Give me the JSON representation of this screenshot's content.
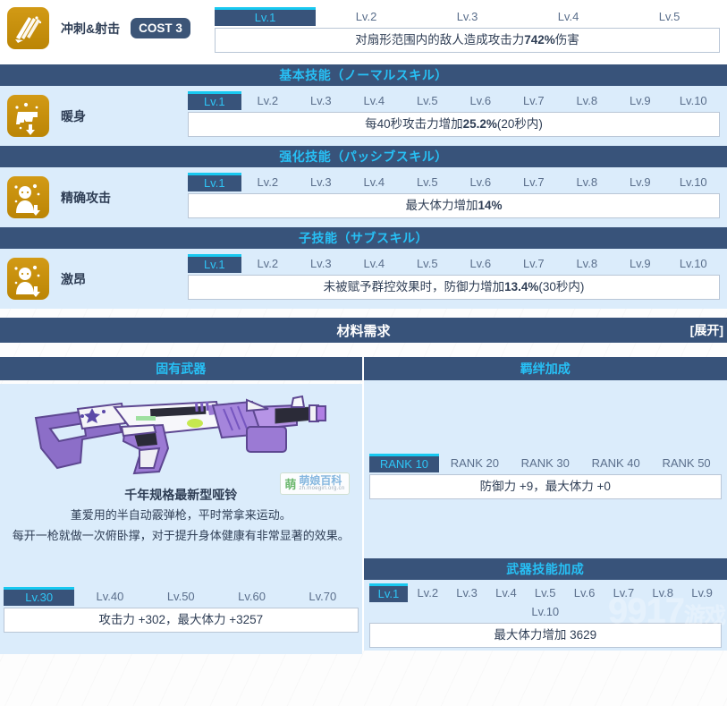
{
  "ultimate": {
    "icon": "slash-impact-icon",
    "name": "冲刺&射击",
    "cost_label": "COST 3",
    "levels": [
      "Lv.1",
      "Lv.2",
      "Lv.3",
      "Lv.4",
      "Lv.5"
    ],
    "active_level": "Lv.1",
    "description": "对扇形范围内的敌人造成攻击力742%伤害"
  },
  "sections": [
    {
      "header": "基本技能（ノーマルスキル）",
      "icon": "pistol-up-icon",
      "name": "暖身",
      "levels": [
        "Lv.1",
        "Lv.2",
        "Lv.3",
        "Lv.4",
        "Lv.5",
        "Lv.6",
        "Lv.7",
        "Lv.8",
        "Lv.9",
        "Lv.10"
      ],
      "active_level": "Lv.1",
      "description": "每40秒攻击力增加25.2%(20秒内)"
    },
    {
      "header": "强化技能（パッシブスキル）",
      "icon": "character-up-icon",
      "name": "精确攻击",
      "levels": [
        "Lv.1",
        "Lv.2",
        "Lv.3",
        "Lv.4",
        "Lv.5",
        "Lv.6",
        "Lv.7",
        "Lv.8",
        "Lv.9",
        "Lv.10"
      ],
      "active_level": "Lv.1",
      "description": "最大体力增加14%"
    },
    {
      "header": "子技能（サブスキル）",
      "icon": "character-up-icon",
      "name": "激昂",
      "levels": [
        "Lv.1",
        "Lv.2",
        "Lv.3",
        "Lv.4",
        "Lv.5",
        "Lv.6",
        "Lv.7",
        "Lv.8",
        "Lv.9",
        "Lv.10"
      ],
      "active_level": "Lv.1",
      "description": "未被赋予群控效果时，防御力增加13.4%(30秒内)"
    }
  ],
  "material": {
    "title": "材料需求",
    "expand_label": "[展开]"
  },
  "weapon": {
    "column_title": "固有武器",
    "name": "千年规格最新型哑铃",
    "desc_line1": "堇爱用的半自动霰弹枪，平时常拿来运动。",
    "desc_line2": "每开一枪就做一次俯卧撑，对于提升身体健康有非常显著的效果。",
    "levels": [
      "Lv.30",
      "Lv.40",
      "Lv.50",
      "Lv.60",
      "Lv.70"
    ],
    "active_level": "Lv.30",
    "stats": "攻击力 +302，最大体力 +3257"
  },
  "bond": {
    "column_title": "羁绊加成",
    "ranks": [
      "RANK 10",
      "RANK 20",
      "RANK 30",
      "RANK 40",
      "RANK 50"
    ],
    "active_rank": "RANK 10",
    "stats": "防御力 +9，最大体力 +0"
  },
  "weapon_skill": {
    "header": "武器技能加成",
    "levels": [
      "Lv.1",
      "Lv.2",
      "Lv.3",
      "Lv.4",
      "Lv.5",
      "Lv.6",
      "Lv.7",
      "Lv.8",
      "Lv.9",
      "Lv.10"
    ],
    "active_level": "Lv.1",
    "description": "最大体力增加 3629"
  },
  "watermarks": {
    "moegirl_char": "萌",
    "moegirl_text": "萌娘百科",
    "moegirl_url": "zh.moegirl.org.cn",
    "site": "9917",
    "site_suffix": "游戏"
  },
  "colors": {
    "header_bg": "#38537a",
    "accent_cyan": "#27c0f5",
    "panel_bg": "#dbecfb",
    "icon_gold": "#c78f0c"
  }
}
